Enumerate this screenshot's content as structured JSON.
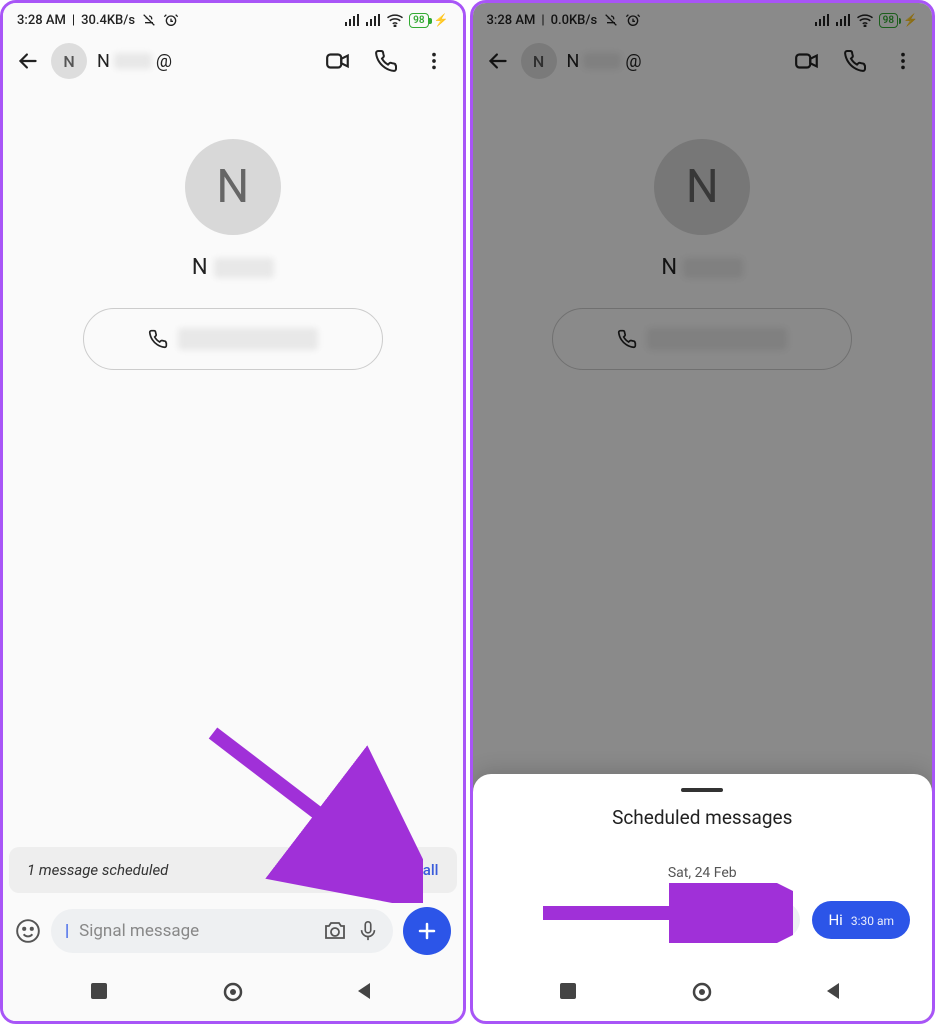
{
  "left": {
    "status": {
      "time": "3:28 AM",
      "speed": "30.4KB/s",
      "battery": "98"
    },
    "header": {
      "avatar_initial": "N",
      "name_initial": "N",
      "at": "@"
    },
    "body": {
      "avatar_initial": "N",
      "name_initial": "N"
    },
    "banner": {
      "text": "1 message scheduled",
      "action": "See all"
    },
    "input": {
      "placeholder": "Signal message"
    }
  },
  "right": {
    "status": {
      "time": "3:28 AM",
      "speed": "0.0KB/s",
      "battery": "98"
    },
    "header": {
      "avatar_initial": "N",
      "name_initial": "N",
      "at": "@"
    },
    "body": {
      "avatar_initial": "N",
      "name_initial": "N"
    },
    "sheet": {
      "title": "Scheduled messages",
      "date": "Sat, 24 Feb",
      "message_text": "Hi",
      "message_time": "3:30 am"
    }
  }
}
